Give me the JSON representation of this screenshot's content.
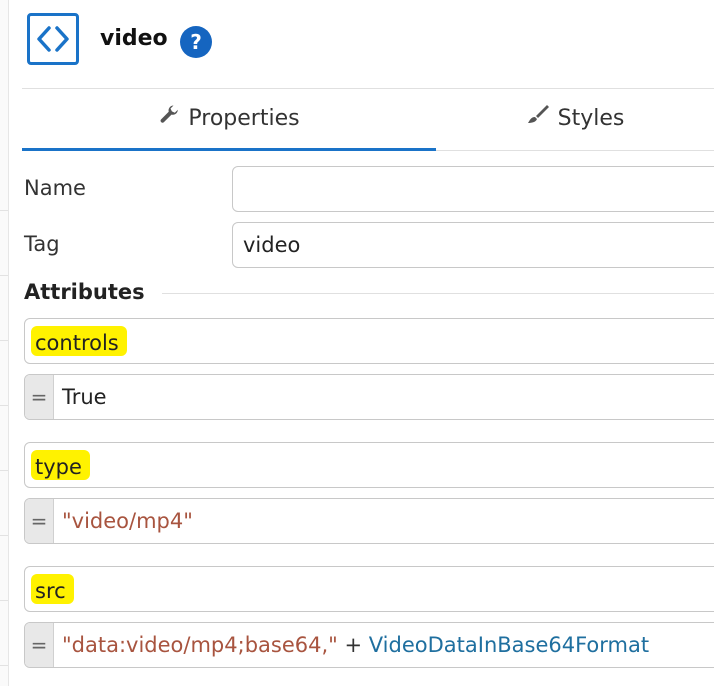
{
  "header": {
    "title": "video",
    "help_symbol": "?",
    "icon": "code-brackets-icon"
  },
  "tabs": [
    {
      "label": "Properties",
      "icon": "wrench-icon",
      "active": true
    },
    {
      "label": "Styles",
      "icon": "paintbrush-icon",
      "active": false
    }
  ],
  "fields": {
    "name": {
      "label": "Name",
      "value": ""
    },
    "tag": {
      "label": "Tag",
      "value": "video"
    }
  },
  "attributes": {
    "heading": "Attributes",
    "items": [
      {
        "name": "controls",
        "equals": "=",
        "value_parts": [
          {
            "text": "True",
            "kind": "keyword"
          }
        ]
      },
      {
        "name": "type",
        "equals": "=",
        "value_parts": [
          {
            "text": "\"video/mp4\"",
            "kind": "string"
          }
        ]
      },
      {
        "name": "src",
        "equals": "=",
        "value_parts": [
          {
            "text": "\"data:video/mp4;base64,\"",
            "kind": "string"
          },
          {
            "text": " + ",
            "kind": "operator"
          },
          {
            "text": "VideoDataInBase64Format",
            "kind": "identifier"
          }
        ]
      }
    ]
  },
  "colors": {
    "accent": "#1a73c8",
    "highlight": "#fff200",
    "string": "#a8543f",
    "identifier": "#1f6f9f"
  }
}
